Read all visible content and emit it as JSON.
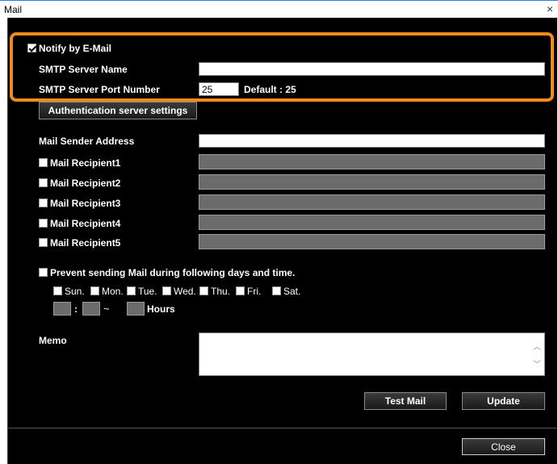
{
  "window": {
    "title": "Mail",
    "close_glyph": "×"
  },
  "notify": {
    "label": "Notify by E-Mail",
    "checked": true
  },
  "smtp": {
    "server_name_label": "SMTP Server Name",
    "server_name_value": "",
    "port_label": "SMTP Server Port Number",
    "port_value": "25",
    "port_default": "Default : 25"
  },
  "auth_button": "Authentication server settings",
  "sender": {
    "label": "Mail Sender Address",
    "value": ""
  },
  "recipients": [
    {
      "label": "Mail Recipient1",
      "checked": false
    },
    {
      "label": "Mail Recipient2",
      "checked": false
    },
    {
      "label": "Mail Recipient3",
      "checked": false
    },
    {
      "label": "Mail Recipient4",
      "checked": false
    },
    {
      "label": "Mail Recipient5",
      "checked": false
    }
  ],
  "prevent": {
    "label": "Prevent sending Mail during following days and time.",
    "checked": false,
    "days": [
      "Sun.",
      "Mon.",
      "Tue.",
      "Wed.",
      "Thu.",
      "Fri.",
      "Sat."
    ],
    "colon": ":",
    "tilde": "~",
    "hours_label": "Hours"
  },
  "memo": {
    "label": "Memo",
    "value": ""
  },
  "buttons": {
    "test_mail": "Test Mail",
    "update": "Update",
    "close": "Close"
  },
  "colors": {
    "highlight": "#f08a1c",
    "panel_bg": "#000000",
    "disabled_field": "#6b6b6b"
  }
}
